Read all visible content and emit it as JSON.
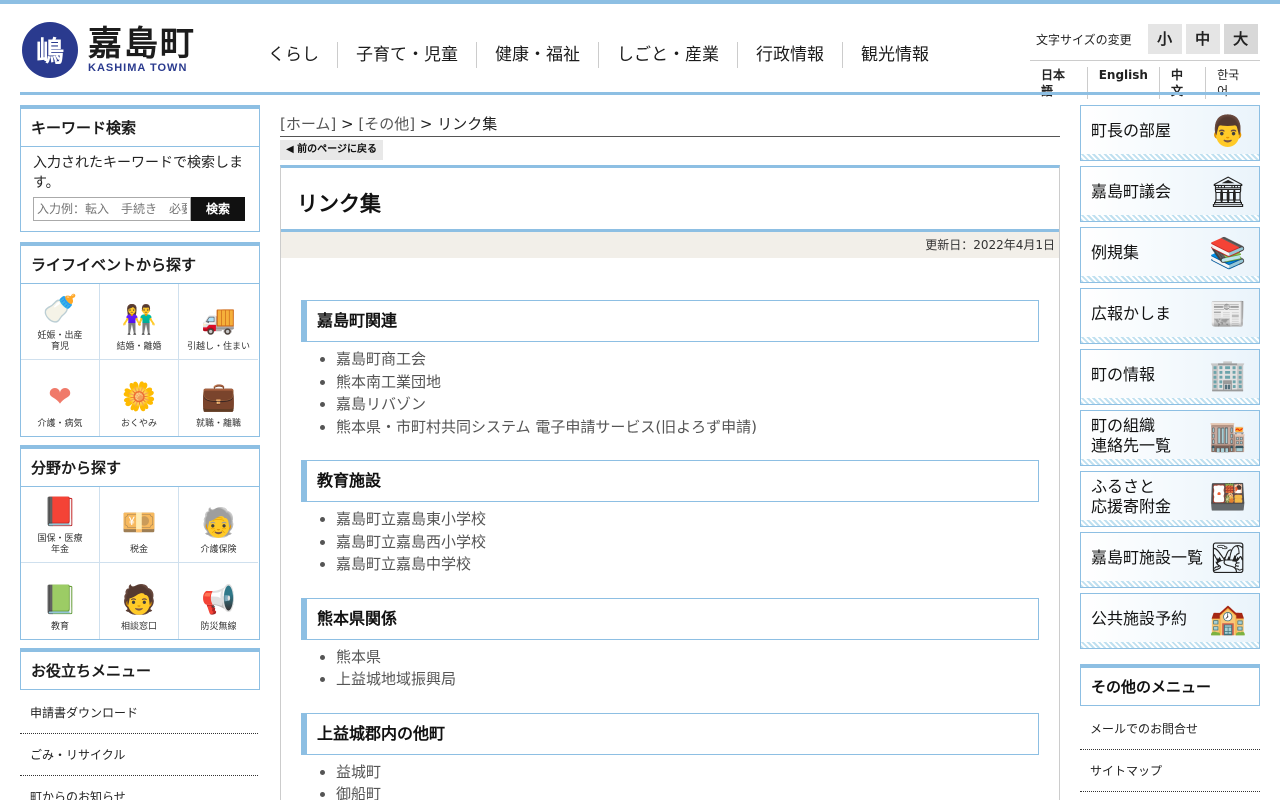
{
  "header": {
    "logo_mark": "嶋",
    "logo_name": "嘉島町",
    "logo_sub": "KASHIMA TOWN",
    "nav": [
      "くらし",
      "子育て・児童",
      "健康・福祉",
      "しごと・産業",
      "行政情報",
      "観光情報"
    ],
    "fontsize_label": "文字サイズの変更",
    "fontsize_buttons": [
      "小",
      "中",
      "大"
    ],
    "languages": [
      "日本語",
      "English",
      "中文",
      "한국어"
    ]
  },
  "keyword": {
    "title": "キーワード検索",
    "desc": "入力されたキーワードで検索します。",
    "placeholder": "入力例：転入　手続き　必要なもの",
    "button": "検索"
  },
  "life_events": {
    "title": "ライフイベントから探す",
    "items": [
      {
        "label": "妊娠・出産\n育児",
        "icon": "baby-bottle-icon",
        "glyph": "🍼",
        "color": "#f08a3a"
      },
      {
        "label": "結婚・離婚",
        "icon": "couple-icon",
        "glyph": "👫",
        "color": "#2a7fd4"
      },
      {
        "label": "引越し・住まい",
        "icon": "moving-truck-icon",
        "glyph": "🚚",
        "color": "#4a7a3a"
      },
      {
        "label": "介護・病気",
        "icon": "heart-syringe-icon",
        "glyph": "❤",
        "color": "#f07a6a"
      },
      {
        "label": "おくやみ",
        "icon": "lotus-icon",
        "glyph": "🌼",
        "color": "#f0c020"
      },
      {
        "label": "就職・離職",
        "icon": "briefcase-icon",
        "glyph": "💼",
        "color": "#6aaed6"
      }
    ]
  },
  "categories": {
    "title": "分野から探す",
    "items": [
      {
        "label": "国保・医療\n年金",
        "icon": "insurance-books-icon",
        "glyph": "📕",
        "color": "#e85a2a"
      },
      {
        "label": "税金",
        "icon": "tax-money-icon",
        "glyph": "💴",
        "color": "#c8b060"
      },
      {
        "label": "介護保険",
        "icon": "elderly-icon",
        "glyph": "🧓",
        "color": "#7a7a9a"
      },
      {
        "label": "教育",
        "icon": "book-pencil-icon",
        "glyph": "📗",
        "color": "#5a9a2a"
      },
      {
        "label": "相談窓口",
        "icon": "consultation-desk-icon",
        "glyph": "🧑",
        "color": "#1a5aa0"
      },
      {
        "label": "防災無線",
        "icon": "siren-icon",
        "glyph": "📢",
        "color": "#f0a020"
      }
    ]
  },
  "useful_menu": {
    "title": "お役立ちメニュー",
    "items": [
      "申請書ダウンロード",
      "ごみ・リサイクル",
      "町からのお知らせ"
    ]
  },
  "breadcrumb": {
    "home": "[ホーム]",
    "sep": " > ",
    "other": "[その他]",
    "current": "リンク集"
  },
  "back_button": "前のページに戻る",
  "page": {
    "title": "リンク集",
    "updated": "更新日：2022年4月1日"
  },
  "sections": [
    {
      "heading": "嘉島町関連",
      "links": [
        "嘉島町商工会",
        "熊本南工業団地",
        "嘉島リバゾン",
        "熊本県・市町村共同システム 電子申請サービス(旧よろず申請)"
      ]
    },
    {
      "heading": "教育施設",
      "links": [
        "嘉島町立嘉島東小学校",
        "嘉島町立嘉島西小学校",
        "嘉島町立嘉島中学校"
      ]
    },
    {
      "heading": "熊本県関係",
      "links": [
        "熊本県",
        "上益城地域振興局"
      ]
    },
    {
      "heading": "上益城郡内の他町",
      "links": [
        "益城町",
        "御船町"
      ]
    }
  ],
  "banners": [
    {
      "label": "町長の部屋",
      "icon": "mayor-photo-icon",
      "glyph": "👨"
    },
    {
      "label": "嘉島町議会",
      "icon": "council-hall-icon",
      "glyph": "🏛"
    },
    {
      "label": "例規集",
      "icon": "law-books-icon",
      "glyph": "📚"
    },
    {
      "label": "広報かしま",
      "icon": "magazine-icon",
      "glyph": "📰"
    },
    {
      "label": "町の情報",
      "icon": "town-building-icon",
      "glyph": "🏢"
    },
    {
      "label": "町の組織\n連絡先一覧",
      "icon": "office-icon",
      "glyph": "🏬"
    },
    {
      "label": "ふるさと\n応援寄附金",
      "icon": "food-gift-icon",
      "glyph": "🍱"
    },
    {
      "label": "嘉島町施設一覧",
      "icon": "landscape-icon",
      "glyph": "🏞"
    },
    {
      "label": "公共施設予約",
      "icon": "facility-icon",
      "glyph": "🏫"
    }
  ],
  "other_menu": {
    "title": "その他のメニュー",
    "items": [
      "メールでのお問合せ",
      "サイトマップ"
    ]
  }
}
